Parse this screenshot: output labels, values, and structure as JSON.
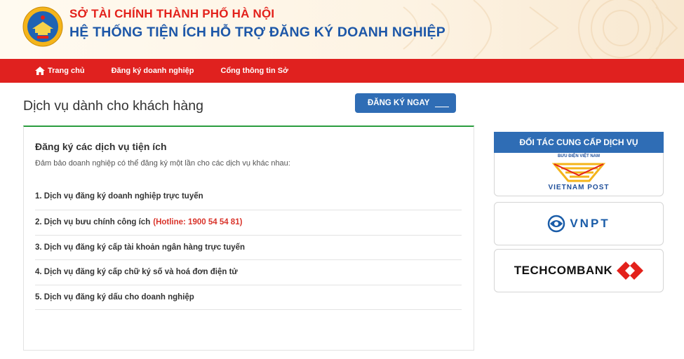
{
  "header": {
    "title_line1": "SỞ TÀI CHÍNH THÀNH PHỐ HÀ NỘI",
    "title_line2": "HỆ THỐNG TIỆN ÍCH HỖ TRỢ ĐĂNG KÝ DOANH NGHIỆP"
  },
  "nav": {
    "items": [
      {
        "label": "Trang chủ",
        "icon": "home-icon"
      },
      {
        "label": "Đăng ký doanh nghiệp"
      },
      {
        "label": "Cổng thông tin Sở"
      }
    ]
  },
  "page": {
    "title": "Dịch vụ dành cho khách hàng",
    "register_label": "ĐĂNG KÝ NGAY"
  },
  "panel": {
    "heading": "Đăng ký các dịch vụ tiện ích",
    "description": "Đảm bảo doanh nghiệp có thể đăng ký một lần cho các dịch vụ khác nhau:",
    "services": [
      {
        "label": "1. Dịch vụ đăng ký doanh nghiệp trực tuyến"
      },
      {
        "label": "2. Dịch vụ bưu chính công ích",
        "hotline": "(Hotline: 1900 54 54 81)"
      },
      {
        "label": "3. Dịch vụ đăng ký cấp tài khoản ngân hàng trực tuyến"
      },
      {
        "label": "4. Dịch vụ đăng ký cấp chữ ký số và hoá đơn điện tử"
      },
      {
        "label": "5. Dịch vụ đăng ký dấu cho doanh nghiệp"
      }
    ]
  },
  "partners": {
    "heading": "ĐỐI TÁC CUNG CẤP DỊCH VỤ",
    "vnpost_top": "BƯU ĐIỆN VIỆT NAM",
    "vnpost_name": "VIETNAM POST",
    "vnpt_name": "VNPT",
    "techcombank_name": "TECHCOMBANK"
  },
  "colors": {
    "nav_red": "#e0211f",
    "title_red": "#e3211b",
    "title_blue": "#1d57a8",
    "button_blue": "#2f6db5",
    "panel_accent_green": "#2a9d3e",
    "hotline_red": "#d9342b"
  }
}
